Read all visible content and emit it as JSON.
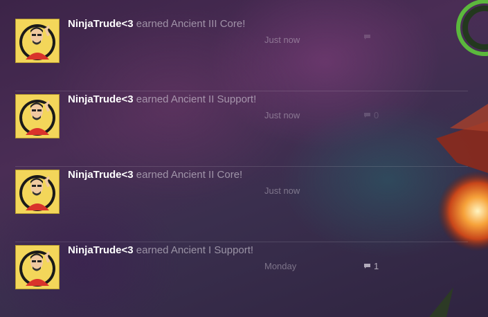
{
  "feed": {
    "items": [
      {
        "username": "NinjaTrude<3",
        "action": " earned Ancient III Core!",
        "time": "Just now",
        "comment_count": ""
      },
      {
        "username": "NinjaTrude<3",
        "action": " earned Ancient II Support!",
        "time": "Just now",
        "comment_count": "0"
      },
      {
        "username": "NinjaTrude<3",
        "action": " earned Ancient II Core!",
        "time": "Just now",
        "comment_count": ""
      },
      {
        "username": "NinjaTrude<3",
        "action": " earned Ancient I Support!",
        "time": "Monday",
        "comment_count": "1"
      }
    ]
  },
  "colors": {
    "avatar_background": "#f3d65a",
    "username": "#ffffff",
    "divider": "rgba(255,255,255,0.13)"
  },
  "icons": {
    "comment": "comment-icon",
    "avatar": "avatar-icon"
  }
}
